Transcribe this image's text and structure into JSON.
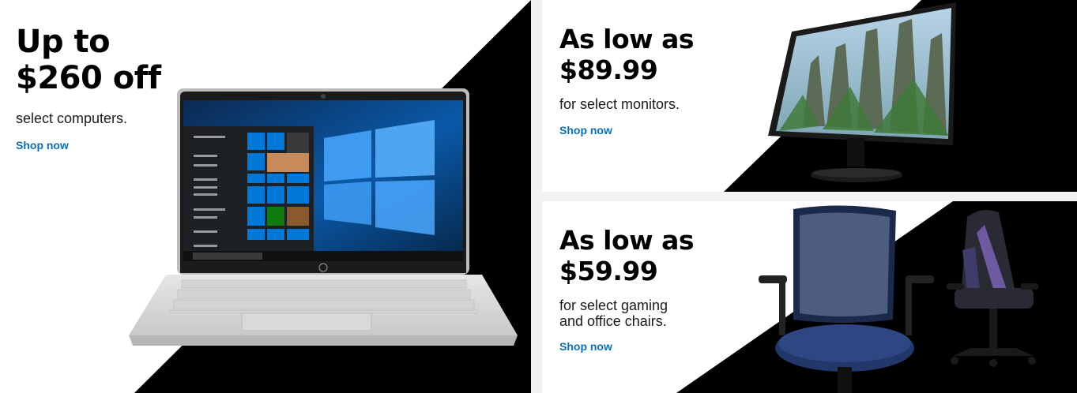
{
  "promos": [
    {
      "headline_line1": "Up to",
      "headline_line2": "$260 off",
      "subtext": "select computers.",
      "link": "Shop now",
      "product": "laptop"
    },
    {
      "headline_line1": "As low as",
      "headline_line2": "$89.99",
      "subtext": "for select monitors.",
      "link": "Shop now",
      "product": "monitor"
    },
    {
      "headline_line1": "As low as",
      "headline_line2": "$59.99",
      "subtext_line1": "for select gaming",
      "subtext_line2": "and office chairs.",
      "link": "Shop now",
      "product": "chairs"
    }
  ],
  "colors": {
    "link": "#0a6fb8",
    "accent_black": "#000000",
    "card_bg": "#ffffff",
    "page_bg": "#f2f2f2",
    "chair_blue": "#23386a"
  }
}
